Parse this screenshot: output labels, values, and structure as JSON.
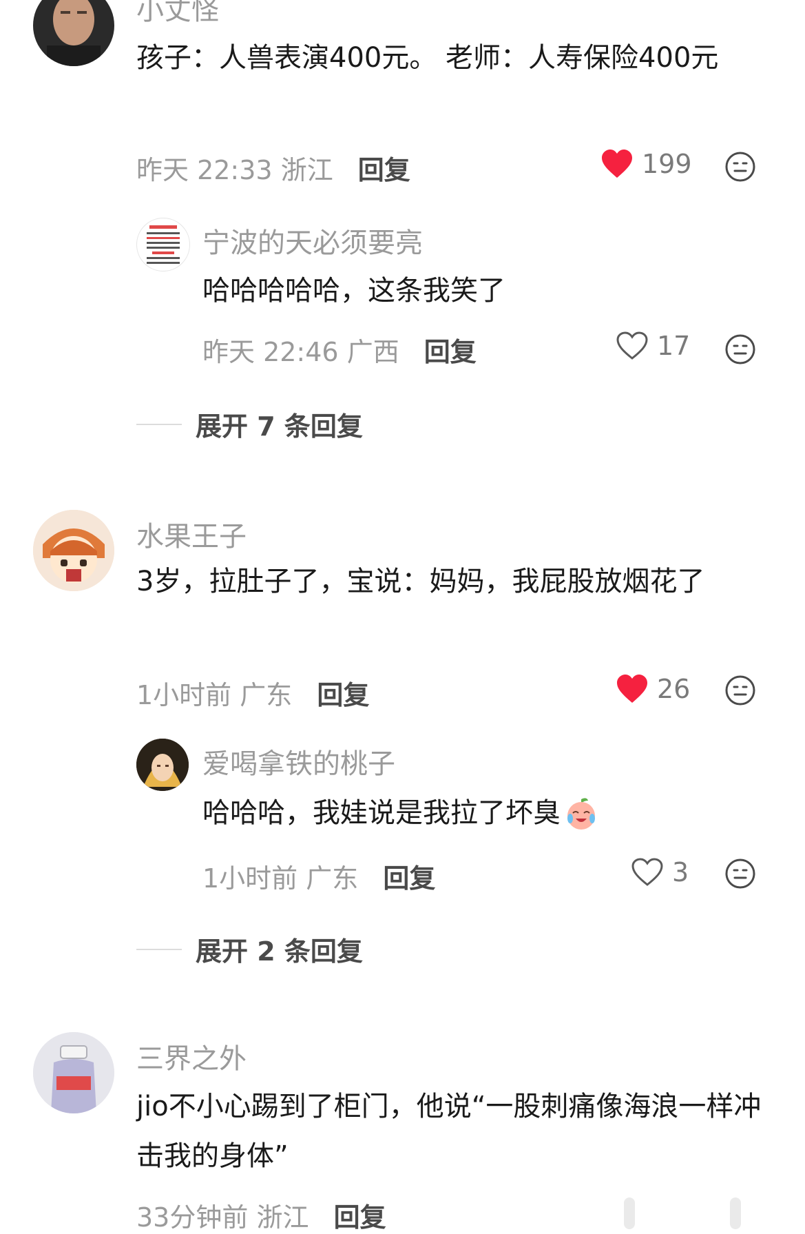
{
  "comments": [
    {
      "username": "小丈怪",
      "text": "孩子：人兽表演400元。 老师：人寿保险400元",
      "time": "昨天 22:33",
      "location": "浙江",
      "reply_label": "回复",
      "likes": "199",
      "liked": true,
      "replies": [
        {
          "username": "宁波的天必须要亮",
          "text": "哈哈哈哈哈，这条我笑了",
          "time": "昨天 22:46",
          "location": "广西",
          "reply_label": "回复",
          "likes": "17",
          "liked": false
        }
      ],
      "expand_label": "展开 7 条回复"
    },
    {
      "username": "水果王子",
      "text": "3岁，拉肚子了，宝说：妈妈，我屁股放烟花了",
      "time": "1小时前",
      "location": "广东",
      "reply_label": "回复",
      "likes": "26",
      "liked": true,
      "replies": [
        {
          "username": "爱喝拿铁的桃子",
          "text": "哈哈哈，我娃说是我拉了坏臭",
          "emoji": "crying-laughing-peach-emoji",
          "time": "1小时前",
          "location": "广东",
          "reply_label": "回复",
          "likes": "3",
          "liked": false
        }
      ],
      "expand_label": "展开 2 条回复"
    },
    {
      "username": "三界之外",
      "text": "jio不小心踢到了柜门，他说“一股刺痛像海浪一样冲击我的身体”",
      "time": "33分钟前",
      "location": "浙江",
      "reply_label": "回复"
    }
  ],
  "colors": {
    "like_red": "#f5213f",
    "muted_text": "#9a9a9a",
    "body_text": "#1a1a1a"
  }
}
